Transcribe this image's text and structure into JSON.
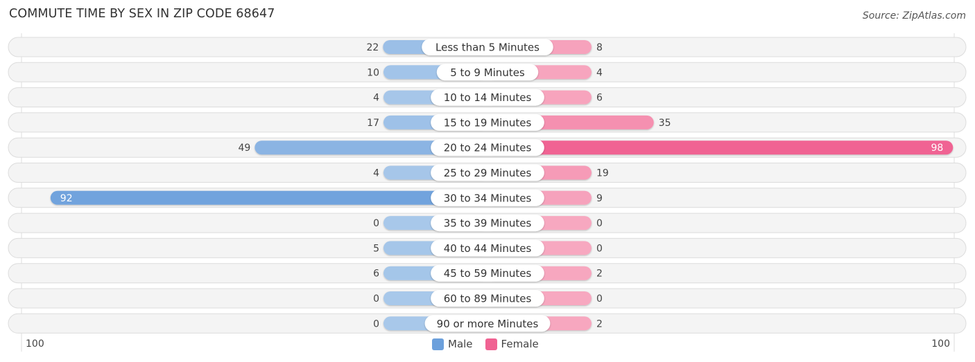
{
  "title": "COMMUTE TIME BY SEX IN ZIP CODE 68647",
  "source": "Source: ZipAtlas.com",
  "legend": [
    {
      "label": "Male",
      "color": "#6ca0dc"
    },
    {
      "label": "Female",
      "color": "#f06292"
    }
  ],
  "axis": {
    "left_label": "100",
    "right_label": "100"
  },
  "chart_data": {
    "type": "bar",
    "orientation": "horizontal-diverging",
    "title": "COMMUTE TIME BY SEX IN ZIP CODE 68647",
    "categories": [
      "Less than 5 Minutes",
      "5 to 9 Minutes",
      "10 to 14 Minutes",
      "15 to 19 Minutes",
      "20 to 24 Minutes",
      "25 to 29 Minutes",
      "30 to 34 Minutes",
      "35 to 39 Minutes",
      "40 to 44 Minutes",
      "45 to 59 Minutes",
      "60 to 89 Minutes",
      "90 or more Minutes"
    ],
    "series": [
      {
        "name": "Male",
        "values": [
          22,
          10,
          4,
          17,
          49,
          4,
          92,
          0,
          5,
          6,
          0,
          0
        ]
      },
      {
        "name": "Female",
        "values": [
          8,
          4,
          6,
          35,
          98,
          19,
          9,
          0,
          0,
          2,
          0,
          2
        ]
      }
    ],
    "xlim": [
      -100,
      100
    ],
    "legend_position": "bottom-center",
    "grid": false
  }
}
